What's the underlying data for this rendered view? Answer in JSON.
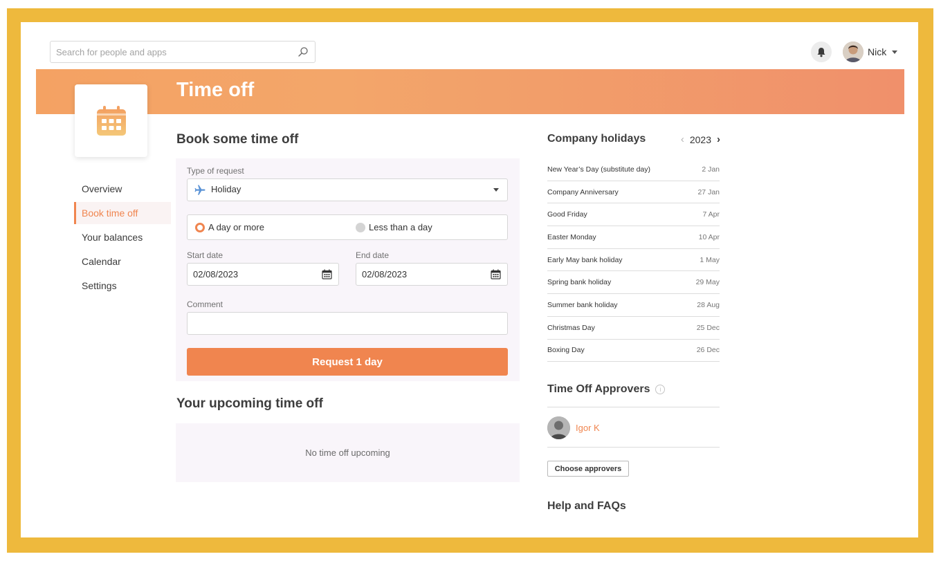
{
  "search": {
    "placeholder": "Search for people and apps",
    "icon": "search-icon"
  },
  "header": {
    "user_name": "Nick",
    "notification_icon": "bell-icon"
  },
  "banner": {
    "title": "Time off",
    "app_icon": "calendar-icon"
  },
  "sidebar": {
    "items": [
      {
        "label": "Overview",
        "active": false
      },
      {
        "label": "Book time off",
        "active": true
      },
      {
        "label": "Your balances",
        "active": false
      },
      {
        "label": "Calendar",
        "active": false
      },
      {
        "label": "Settings",
        "active": false
      }
    ]
  },
  "book": {
    "title": "Book some time off",
    "type_label": "Type of request",
    "type_value": "Holiday",
    "duration_options": [
      {
        "label": "A day or more",
        "selected": true
      },
      {
        "label": "Less than a day",
        "selected": false
      }
    ],
    "start_label": "Start date",
    "start_value": "02/08/2023",
    "end_label": "End date",
    "end_value": "02/08/2023",
    "comment_label": "Comment",
    "comment_value": "",
    "submit_label": "Request 1 day"
  },
  "upcoming": {
    "title": "Your upcoming time off",
    "empty_text": "No time off upcoming"
  },
  "holidays": {
    "title": "Company holidays",
    "year": "2023",
    "items": [
      {
        "name": "New Year’s Day (substitute day)",
        "date": "2 Jan"
      },
      {
        "name": "Company Anniversary",
        "date": "27 Jan"
      },
      {
        "name": "Good Friday",
        "date": "7 Apr"
      },
      {
        "name": "Easter Monday",
        "date": "10 Apr"
      },
      {
        "name": "Early May bank holiday",
        "date": "1 May"
      },
      {
        "name": "Spring bank holiday",
        "date": "29 May"
      },
      {
        "name": "Summer bank holiday",
        "date": "28 Aug"
      },
      {
        "name": "Christmas Day",
        "date": "25 Dec"
      },
      {
        "name": "Boxing Day",
        "date": "26 Dec"
      }
    ]
  },
  "approvers": {
    "title": "Time Off Approvers",
    "people": [
      {
        "name": "Igor K"
      }
    ],
    "choose_label": "Choose approvers"
  },
  "help": {
    "title": "Help and FAQs"
  },
  "colors": {
    "accent": "#f0854f",
    "frame": "#eeb93d",
    "panel": "#f9f5fa"
  }
}
